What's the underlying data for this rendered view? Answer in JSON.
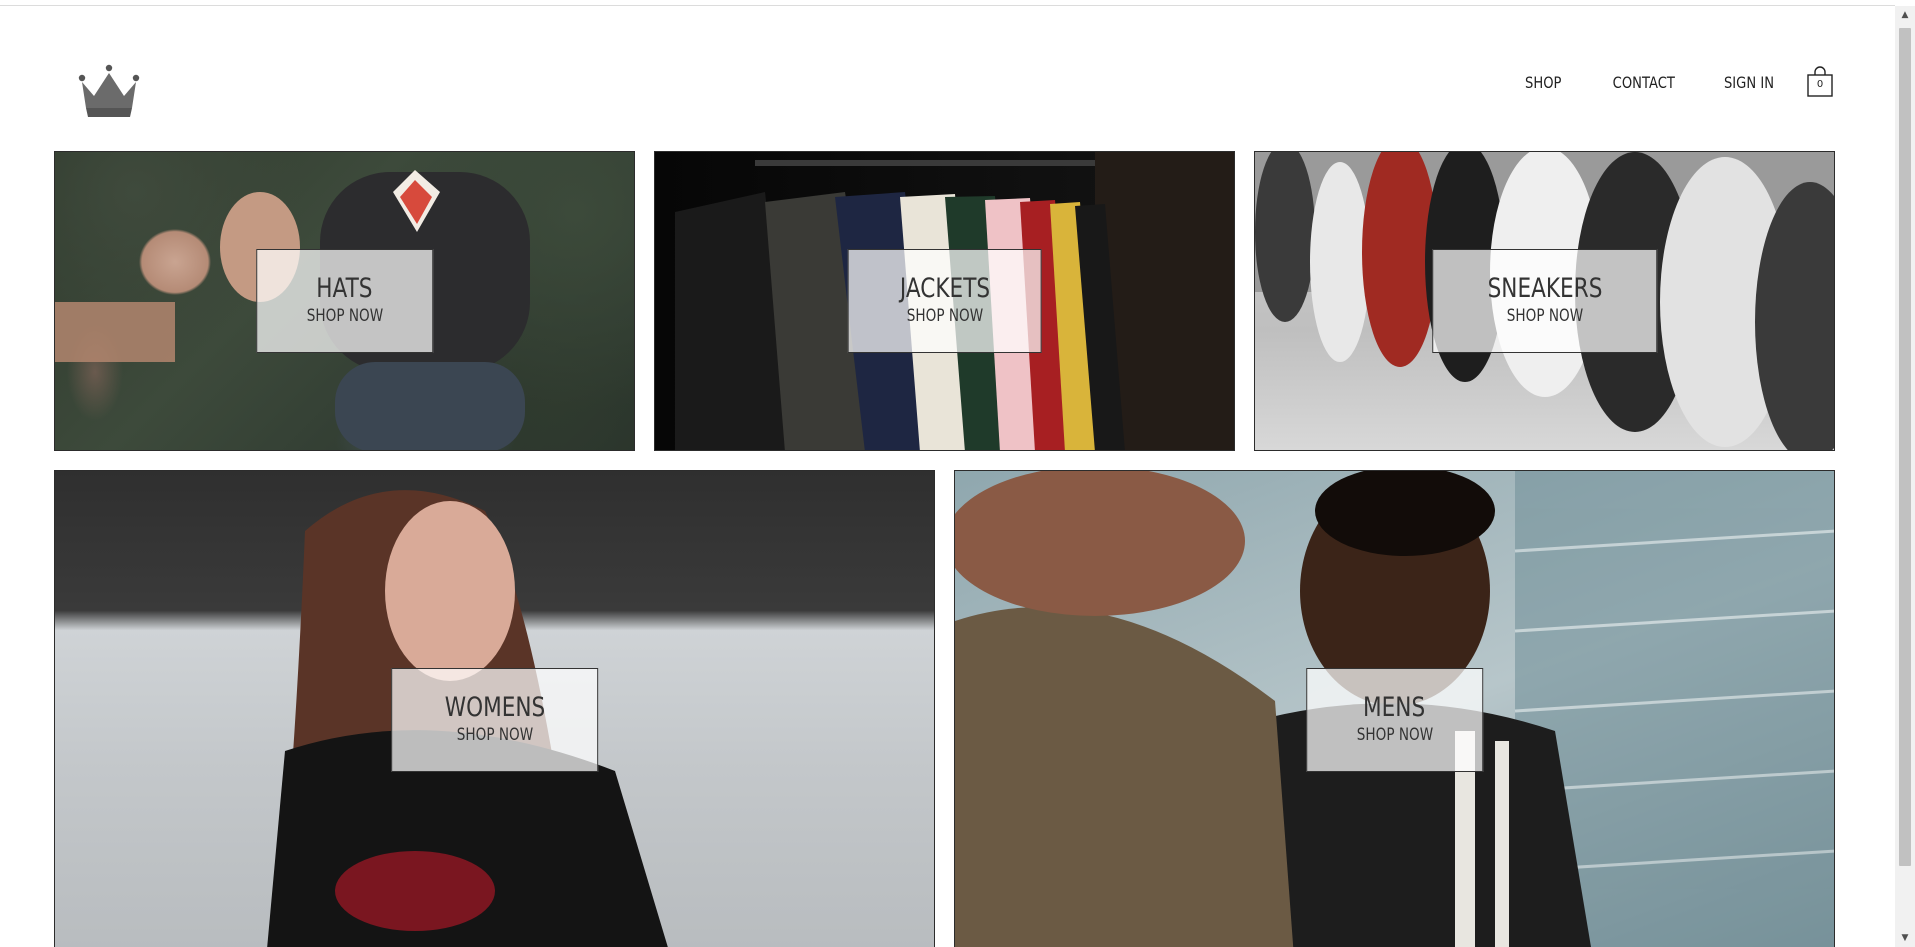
{
  "nav": {
    "shop": "SHOP",
    "contact": "CONTACT",
    "sign_in": "SIGN IN",
    "cart_count": "0"
  },
  "icons": {
    "logo": "crown-icon",
    "cart": "shopping-bag-icon"
  },
  "categories": [
    {
      "title": "HATS",
      "cta": "SHOP NOW"
    },
    {
      "title": "JACKETS",
      "cta": "SHOP NOW"
    },
    {
      "title": "SNEAKERS",
      "cta": "SHOP NOW"
    },
    {
      "title": "WOMENS",
      "cta": "SHOP NOW"
    },
    {
      "title": "MENS",
      "cta": "SHOP NOW"
    }
  ]
}
